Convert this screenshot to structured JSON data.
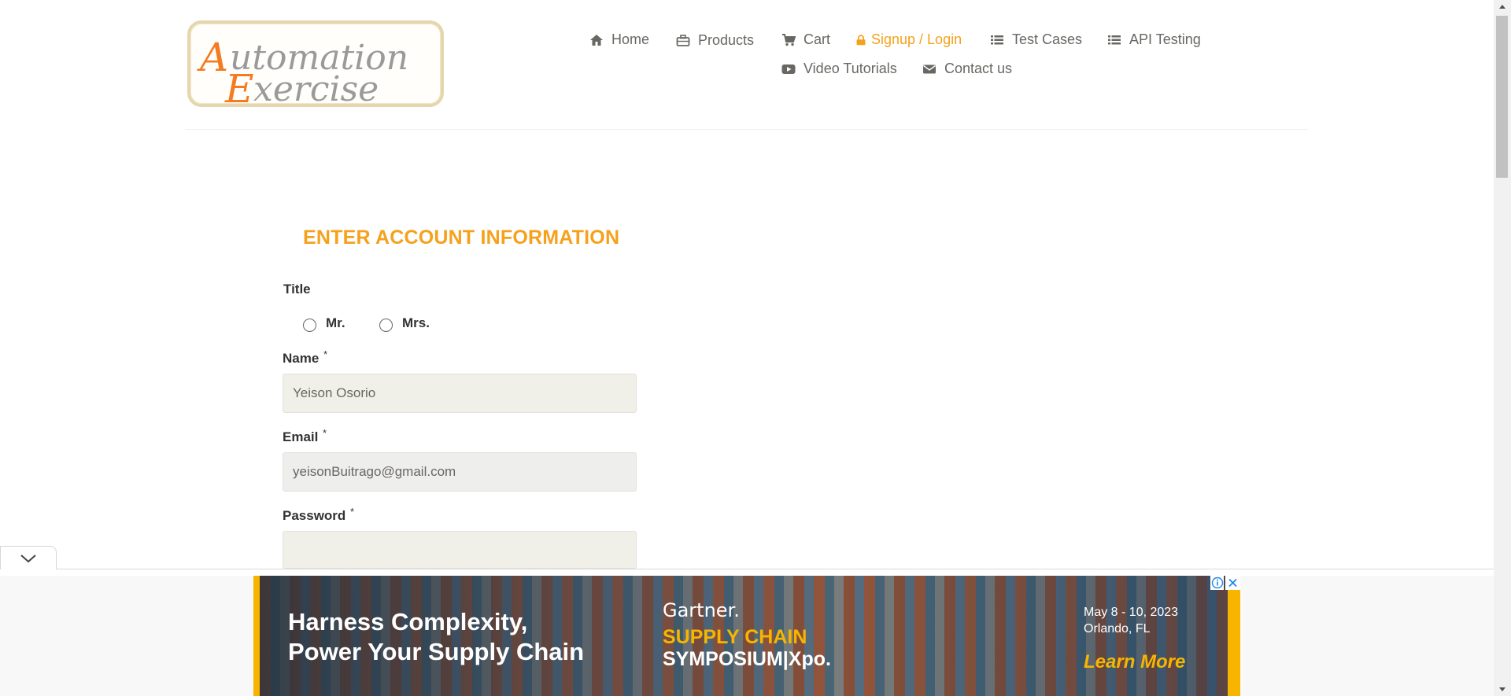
{
  "logo": {
    "line1": "Automation",
    "line2": "Exercise"
  },
  "nav": {
    "home": "Home",
    "products": "Products",
    "cart": "Cart",
    "signup_login": "Signup / Login",
    "test_cases": "Test Cases",
    "api_testing": "API Testing",
    "video_tutorials": "Video Tutorials",
    "contact_us": "Contact us"
  },
  "form": {
    "heading": "ENTER ACCOUNT INFORMATION",
    "title_label": "Title",
    "title_options": [
      "Mr.",
      "Mrs."
    ],
    "name_label": "Name",
    "name_value": "Yeison Osorio",
    "email_label": "Email",
    "email_value": "yeisonBuitrago@gmail.com",
    "password_label": "Password",
    "password_value": "",
    "required_mark": "*"
  },
  "ad": {
    "headline_1": "Harness Complexity,",
    "headline_2": "Power Your Supply Chain",
    "brand": "Gartner.",
    "event_1": "SUPPLY CHAIN",
    "event_2": "SYMPOSIUM|Xpo.",
    "date_1": "May 8 - 10, 2023",
    "date_2": "Orlando, FL",
    "cta": "Learn More"
  },
  "colors": {
    "accent": "#f5a11c",
    "text": "#696763",
    "field_bg": "#f0f0e9",
    "ad_yellow": "#f7b500"
  }
}
